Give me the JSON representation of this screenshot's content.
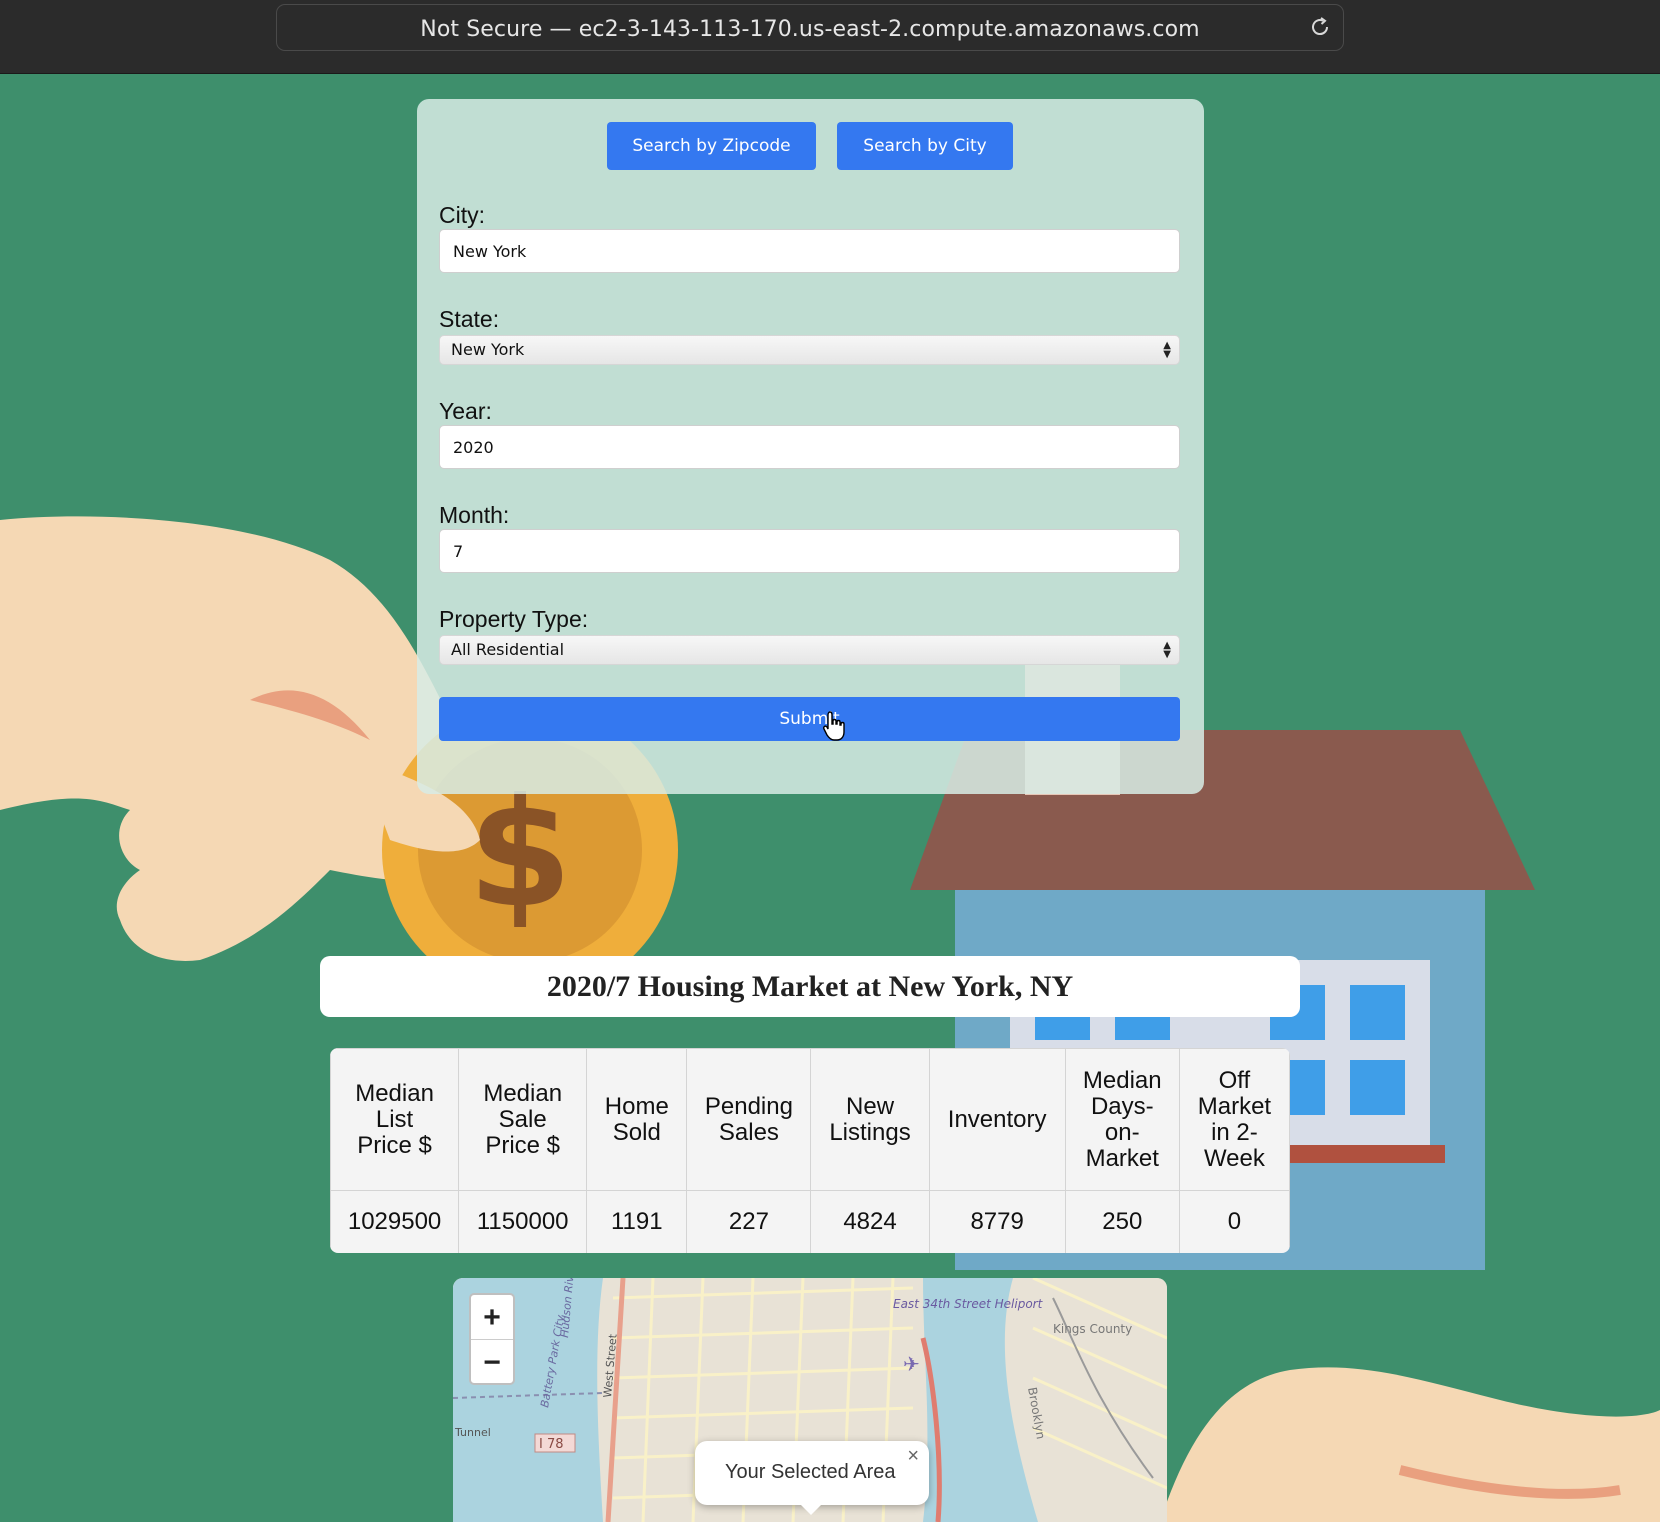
{
  "browser": {
    "address": "Not Secure — ec2-3-143-113-170.us-east-2.compute.amazonaws.com"
  },
  "search": {
    "zipcode_button": "Search by Zipcode",
    "city_button": "Search by City"
  },
  "form": {
    "city_label": "City:",
    "city_value": "New York",
    "state_label": "State:",
    "state_value": "New York",
    "year_label": "Year:",
    "year_value": "2020",
    "month_label": "Month:",
    "month_value": "7",
    "property_label": "Property Type:",
    "property_value": "All Residential",
    "submit_label": "Submit"
  },
  "result": {
    "title": "2020/7 Housing Market at New York, NY",
    "headers": [
      [
        "Median",
        "List",
        "Price $"
      ],
      [
        "Median",
        "Sale",
        "Price $"
      ],
      [
        "Home",
        "Sold"
      ],
      [
        "Pending",
        "Sales"
      ],
      [
        "New",
        "Listings"
      ],
      [
        "Inventory"
      ],
      [
        "Median",
        "Days-",
        "on-",
        "Market"
      ],
      [
        "Off",
        "Market",
        "in 2-",
        "Week"
      ]
    ],
    "values": [
      "1029500",
      "1150000",
      "1191",
      "227",
      "4824",
      "8779",
      "250",
      "0"
    ]
  },
  "map": {
    "zoom_in": "+",
    "zoom_out": "−",
    "popup_text": "Your Selected Area",
    "popup_close": "×",
    "labels": {
      "heliport": "East 34th Street Heliport",
      "route": "I 78",
      "tunnel": "Tunnel",
      "kings": "Kings County",
      "brooklyn": "Brooklyn",
      "west_street": "West Street",
      "battery": "Battery Park City",
      "hudson": "Hudson River"
    }
  },
  "colors": {
    "background": "#3e8f6c",
    "accent": "#3478f0",
    "card": "#d7ebe4"
  }
}
